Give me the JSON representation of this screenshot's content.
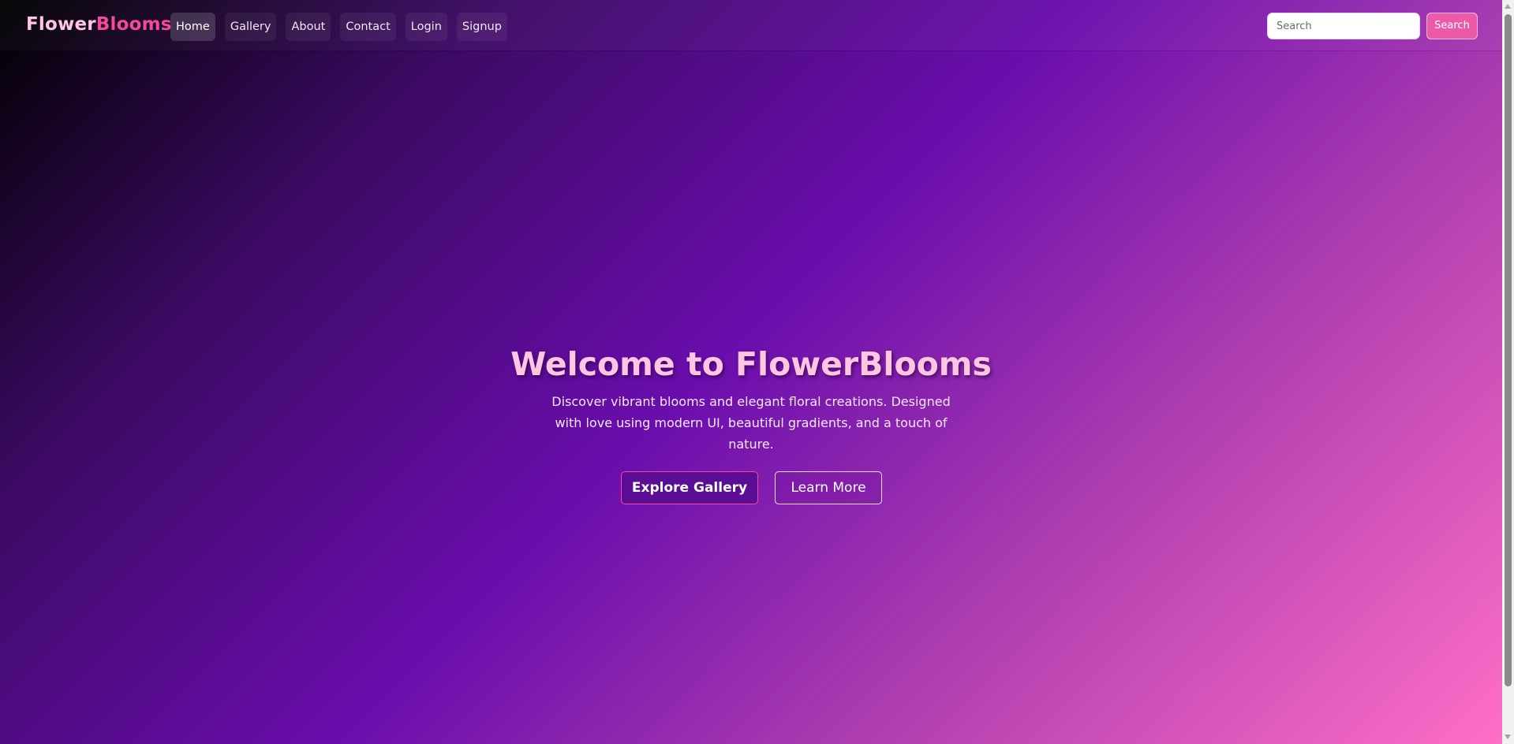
{
  "navbar": {
    "brand_part1": "Flower",
    "brand_part2": "Blooms",
    "links": [
      {
        "label": "Home",
        "active": true
      },
      {
        "label": "Gallery",
        "active": false
      },
      {
        "label": "About",
        "active": false
      },
      {
        "label": "Contact",
        "active": false
      },
      {
        "label": "Login",
        "active": false
      },
      {
        "label": "Signup",
        "active": false
      }
    ],
    "search": {
      "placeholder": "Search",
      "value": "",
      "button_label": "Search"
    }
  },
  "hero": {
    "title": "Welcome to FlowerBlooms",
    "description": "Discover vibrant blooms and elegant floral creations. Designed with love using modern UI, beautiful gradients, and a touch of nature.",
    "primary_button": "Explore Gallery",
    "secondary_button": "Learn More"
  },
  "colors": {
    "accent_pink": "#f4489a",
    "title_pink": "#ffc6e2",
    "purple": "#6a0dad",
    "gradient_end": "#ff6ec7"
  }
}
